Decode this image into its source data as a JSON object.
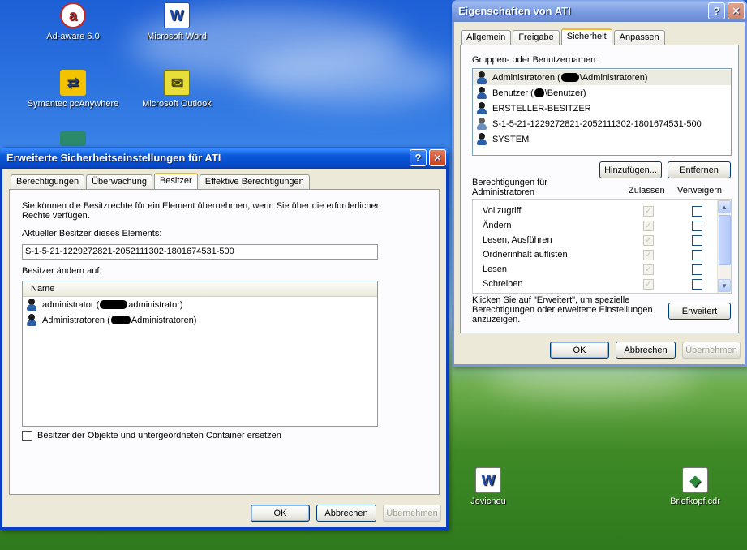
{
  "desktop_icons": [
    {
      "label": "Ad-aware 6.0",
      "icon": "adaware-icon",
      "color": "#c62828"
    },
    {
      "label": "Microsoft Word",
      "icon": "word-icon",
      "color": "#1e4fb0"
    },
    {
      "label": "Symantec pcAnywhere",
      "icon": "pcanywhere-icon",
      "color": "#e0a800"
    },
    {
      "label": "Microsoft Outlook",
      "icon": "outlook-icon",
      "color": "#d6c600"
    },
    {
      "label": "Jovicneu",
      "icon": "word-document-icon",
      "color": "#1e4fb0"
    },
    {
      "label": "Briefkopf.cdr",
      "icon": "coreldraw-file-icon",
      "color": "#2a8a3a"
    }
  ],
  "adv_dialog": {
    "title": "Erweiterte Sicherheitseinstellungen für ATI",
    "help_glyph": "?",
    "close_glyph": "✕",
    "tabs": [
      "Berechtigungen",
      "Überwachung",
      "Besitzer",
      "Effektive Berechtigungen"
    ],
    "active_tab": 2,
    "intro": "Sie können die Besitzrechte für ein Element übernehmen, wenn Sie über die erforderlichen Rechte verfügen.",
    "current_owner_label": "Aktueller Besitzer dieses Elements:",
    "current_owner_value": "S-1-5-21-1229272821-2052111302-1801674531-500",
    "change_owner_label": "Besitzer ändern auf:",
    "list_header": "Name",
    "owners": [
      {
        "pre": "administrator (",
        "post": "administrator)"
      },
      {
        "pre": "Administratoren (",
        "post": "Administratoren)"
      }
    ],
    "replace_checkbox": "Besitzer der Objekte und untergeordneten Container ersetzen",
    "ok": "OK",
    "cancel": "Abbrechen",
    "apply": "Übernehmen"
  },
  "props_dialog": {
    "title": "Eigenschaften von ATI",
    "help_glyph": "?",
    "close_glyph": "✕",
    "tabs": [
      "Allgemein",
      "Freigabe",
      "Sicherheit",
      "Anpassen"
    ],
    "active_tab": 2,
    "groups_label": "Gruppen- oder Benutzernamen:",
    "users": [
      {
        "pre": "Administratoren (",
        "post": "\\Administratoren)",
        "redacted": true
      },
      {
        "pre": "Benutzer (",
        "post": "\\Benutzer)",
        "redacted": true
      },
      {
        "pre": "ERSTELLER-BESITZER",
        "post": "",
        "redacted": false
      },
      {
        "pre": "S-1-5-21-1229272821-2052111302-1801674531-500",
        "post": "",
        "redacted": false
      },
      {
        "pre": "SYSTEM",
        "post": "",
        "redacted": false
      }
    ],
    "add_button": "Hinzufügen...",
    "remove_button": "Entfernen",
    "perm_for_label": "Berechtigungen für Administratoren",
    "col_allow": "Zulassen",
    "col_deny": "Verweigern",
    "permissions": [
      "Vollzugriff",
      "Ändern",
      "Lesen, Ausführen",
      "Ordnerinhalt auflisten",
      "Lesen",
      "Schreiben"
    ],
    "advanced_hint": "Klicken Sie auf \"Erweitert\", um spezielle Berechtigungen oder erweiterte Einstellungen anzuzeigen.",
    "advanced_button": "Erweitert",
    "ok": "OK",
    "cancel": "Abbrechen",
    "apply": "Übernehmen",
    "check_glyph": "✓",
    "up_glyph": "▲",
    "down_glyph": "▼"
  }
}
